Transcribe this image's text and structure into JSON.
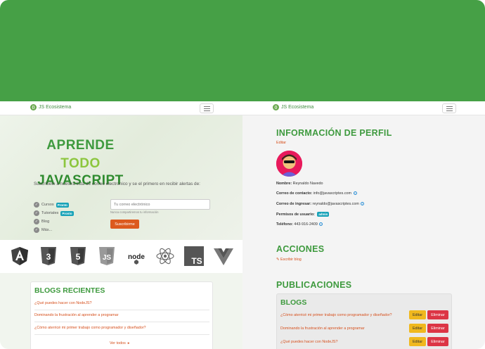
{
  "colors": {
    "top_band": "#46a046",
    "brand_green": "#3e9a3e",
    "accent_orange": "#dc5a1e",
    "badge_blue": "#17a2b8",
    "edit_yellow": "#f0b81e",
    "delete_red": "#dc3545"
  },
  "left": {
    "navbar": {
      "brand": "JS Ecosistema",
      "menu_icon": "hamburger-icon"
    },
    "hero": {
      "line1": "APRENDE",
      "line2": "TODO",
      "line3": "JAVASCRIPT",
      "subscribe_text": "Suscríbete a nuestra lista de correo electrónico y se el primero en recibir alertas de:",
      "bullets": [
        {
          "label": "Cursos",
          "badge": "Pronto"
        },
        {
          "label": "Tutoriales",
          "badge": "Pronto"
        },
        {
          "label": "Blog",
          "badge": ""
        },
        {
          "label": "Más...",
          "badge": ""
        }
      ],
      "email_placeholder": "Tu correo electrónico",
      "email_help": "Nunca compartiremos tu información",
      "subscribe_button": "Suscribirme"
    },
    "tech_icons": [
      "angular-icon",
      "css3-icon",
      "html5-icon",
      "javascript-icon",
      "nodejs-icon",
      "react-icon",
      "typescript-icon",
      "vue-icon"
    ],
    "tech_labels": {
      "node": "node",
      "ts": "TS",
      "js": "JS",
      "css": "3",
      "html": "5"
    },
    "blogs": {
      "title": "BLOGS RECIENTES",
      "items": [
        "¿Qué puedes hacer con NodeJS?",
        "Dominando la frustración al aprender a programar",
        "¿Cómo aterricé mi primer trabajo como programador y diseñador?"
      ],
      "see_all": "Ver todos"
    }
  },
  "right": {
    "navbar": {
      "brand": "JS Ecosistema",
      "menu_icon": "hamburger-icon"
    },
    "profile": {
      "title": "INFORMACIÓN DE PERFIL",
      "edit": "Editar",
      "name_label": "Nombre:",
      "name": "Reynaldo Navedo",
      "contact_label": "Correo de contacto:",
      "contact": "info@javascriptes.com",
      "login_label": "Correo de ingresar:",
      "login": "reynaldo@javascriptes.com",
      "perms_label": "Permisos de usuario:",
      "perms_badge": "admin",
      "phone_label": "Teléfono:",
      "phone": "443-916-2409"
    },
    "actions": {
      "title": "ACCIONES",
      "write_blog": "Escribir blog"
    },
    "publications": {
      "title": "PUBLICACIONES",
      "card_title": "BLOGS",
      "edit_label": "Editar",
      "delete_label": "Eliminar",
      "posts": [
        "¿Cómo aterricé mi primer trabajo como programador y diseñador?",
        "Dominando la frustración al aprender a programar",
        "¿Qué puedes hacer con NodeJS?"
      ]
    }
  }
}
